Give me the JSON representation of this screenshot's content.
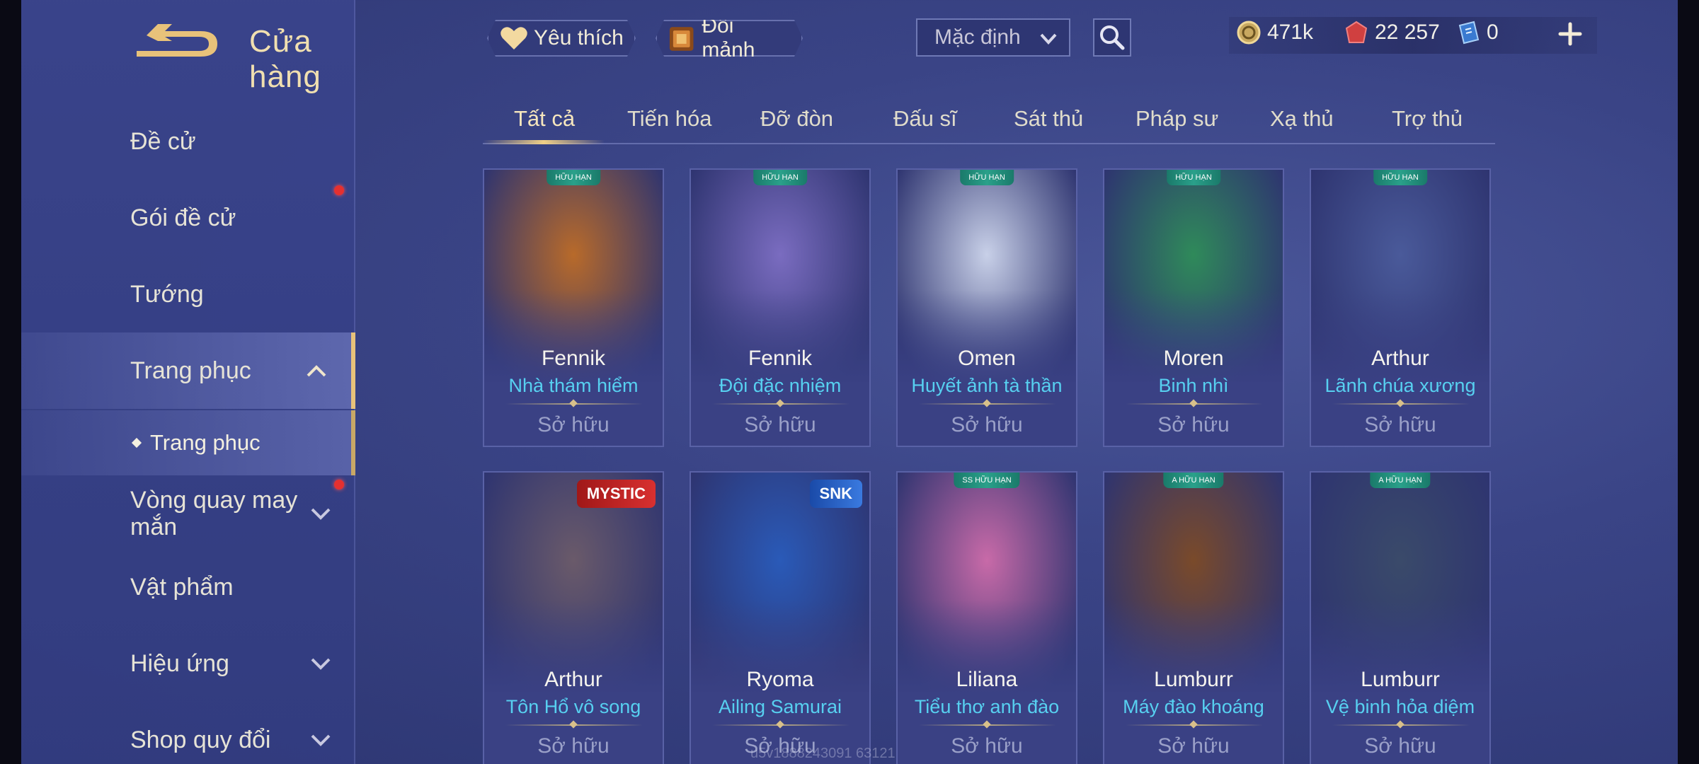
{
  "header": {
    "title": "Cửa hàng",
    "favorite_label": "Yêu thích",
    "exchange_label": "Đổi mảnh",
    "sort_label": "Mặc định",
    "currency": {
      "gold": "471k",
      "vouchers": "22 257",
      "tickets": "0"
    }
  },
  "sidebar": {
    "items": [
      {
        "label": "Đề cử"
      },
      {
        "label": "Gói đề cử"
      },
      {
        "label": "Tướng"
      },
      {
        "label": "Trang phục"
      },
      {
        "label": "Trang phục"
      },
      {
        "label": "Vòng quay may mắn"
      },
      {
        "label": "Vật phẩm"
      },
      {
        "label": "Hiệu ứng"
      },
      {
        "label": "Shop quy đổi"
      }
    ]
  },
  "tabs": [
    "Tất cả",
    "Tiến hóa",
    "Đỡ đòn",
    "Đấu sĩ",
    "Sát thủ",
    "Pháp sư",
    "Xạ thủ",
    "Trợ thủ"
  ],
  "cards": [
    {
      "hero": "Fennik",
      "skin": "Nhà thám hiểm",
      "status": "Sở hữu",
      "badge": "HỮU HẠN",
      "color": "#b86a2a"
    },
    {
      "hero": "Fennik",
      "skin": "Đội đặc nhiệm",
      "status": "Sở hữu",
      "badge": "HỮU HẠN",
      "color": "#7a6cc0"
    },
    {
      "hero": "Omen",
      "skin": "Huyết ảnh tà thần",
      "status": "Sở hữu",
      "badge": "HỮU HẠN",
      "color": "#c8d0e8"
    },
    {
      "hero": "Moren",
      "skin": "Binh nhì",
      "status": "Sở hữu",
      "badge": "HỮU HẠN",
      "color": "#2f8a5a"
    },
    {
      "hero": "Arthur",
      "skin": "Lãnh chúa xương",
      "status": "Sở hữu",
      "badge": "HỮU HẠN",
      "color": "#4a5a9a"
    },
    {
      "hero": "Arthur",
      "skin": "Tôn Hổ vô song",
      "status": "Sở hữu",
      "badge": "MYSTIC",
      "color": "#6a5a6a"
    },
    {
      "hero": "Ryoma",
      "skin": "Ailing Samurai",
      "status": "Sở hữu",
      "badge": "SNK",
      "color": "#2a5ab8"
    },
    {
      "hero": "Liliana",
      "skin": "Tiểu thơ anh đào",
      "status": "Sở hữu",
      "badge": "SS HỮU HẠN",
      "color": "#c86aa8"
    },
    {
      "hero": "Lumburr",
      "skin": "Máy đào khoáng",
      "status": "Sở hữu",
      "badge": "A HỮU HẠN",
      "color": "#7a4a2a"
    },
    {
      "hero": "Lumburr",
      "skin": "Vệ binh hỏa diệm",
      "status": "Sở hữu",
      "badge": "A HỮU HẠN",
      "color": "#3a4a6a"
    }
  ],
  "watermark": "u5v1888243091 63121",
  "colors": {
    "accent_gold": "#f0cf86",
    "skin_name": "#57d0f0",
    "notification": "#e53030"
  }
}
